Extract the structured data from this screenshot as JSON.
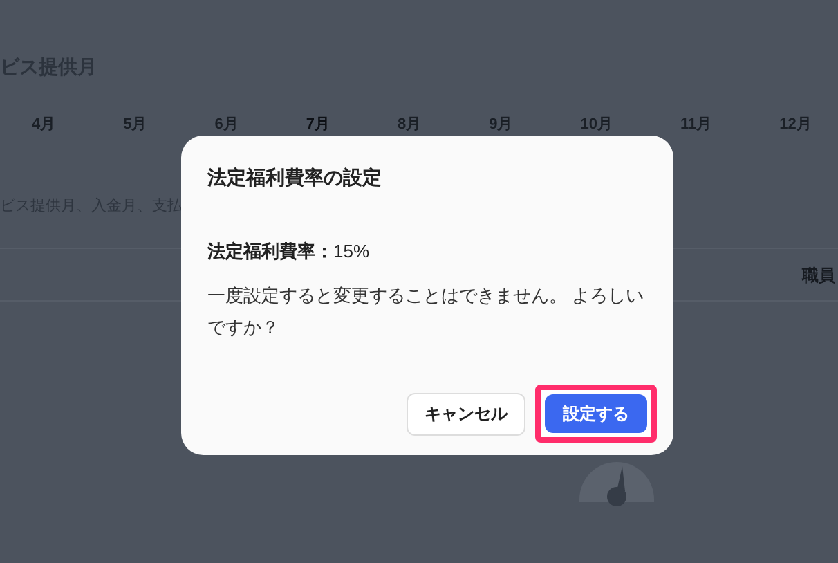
{
  "background": {
    "section_title": "ビス提供月",
    "months": [
      {
        "label": "4月",
        "selected": false
      },
      {
        "label": "5月",
        "selected": false
      },
      {
        "label": "6月",
        "selected": false
      },
      {
        "label": "7月",
        "selected": true
      },
      {
        "label": "8月",
        "selected": false
      },
      {
        "label": "9月",
        "selected": false
      },
      {
        "label": "10月",
        "selected": false
      },
      {
        "label": "11月",
        "selected": false
      },
      {
        "label": "12月",
        "selected": false
      }
    ],
    "description": "ビス提供月、入金月、支払",
    "column_header": "職員"
  },
  "dialog": {
    "title": "法定福利費率の設定",
    "rate": "**法定福利費率：**15%",
    "message": "一度設定すると変更することはできません。 よろしいですか？",
    "buttons": [
      {
        "label": "キャンセル",
        "kind": "secondary",
        "highlighted": false
      },
      {
        "label": "設定する",
        "kind": "primary",
        "highlighted": true
      }
    ]
  }
}
